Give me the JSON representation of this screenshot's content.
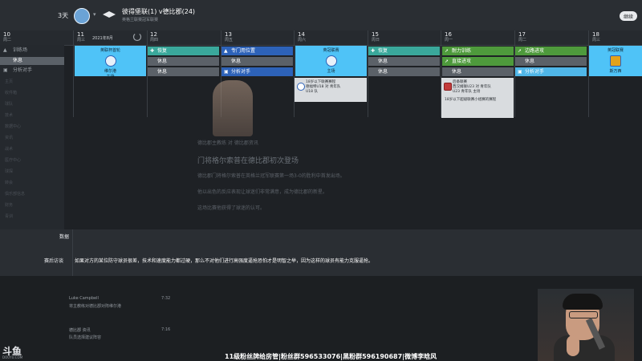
{
  "topbar": {
    "days_left": "3天",
    "match_title": "彼得堡联(1) v德比郡(24)",
    "match_sub": "英格兰联赛冠军联赛",
    "continue_button": "继续"
  },
  "calendar": {
    "month_label": "2021年8月",
    "days": [
      {
        "num": "10",
        "weekday": "周二"
      },
      {
        "num": "11",
        "weekday": "周三"
      },
      {
        "num": "12",
        "weekday": "周四"
      },
      {
        "num": "13",
        "weekday": "周五"
      },
      {
        "num": "14",
        "weekday": "周六"
      },
      {
        "num": "15",
        "weekday": "周日"
      },
      {
        "num": "16",
        "weekday": "周一"
      },
      {
        "num": "17",
        "weekday": "周二"
      },
      {
        "num": "18",
        "weekday": "周三"
      }
    ],
    "events": {
      "d10": [
        "训练场",
        "休息",
        "分析对手"
      ],
      "d11_card": {
        "name": "英联杯首轮",
        "opponent": "维尔港",
        "state": "主场"
      },
      "d12": [
        "恢复",
        "休息",
        "休息"
      ],
      "d13": [
        "专门用位置",
        "休息",
        "分析对手"
      ],
      "d14_card": {
        "name": "英冠联赛",
        "opponent": "",
        "state": "主场"
      },
      "d15": [
        "恢复",
        "休息",
        "休息"
      ],
      "d16": [
        "耐力训练",
        "直接进攻",
        "休息"
      ],
      "d17": [
        "边路进攻",
        "休息",
        "分析对手"
      ],
      "d18_card": {
        "name": "英冠联赛",
        "opponent": "斯万西",
        "state": "客场"
      }
    },
    "popover_a": {
      "line1": "18岁以下联赛赛程",
      "line2": "德福特U18 对 青年队",
      "line3": "U18 队"
    },
    "popover_b": {
      "line1": "后备联赛",
      "line2": "西汉姆联U23 对 青年队",
      "line3": "U23 青年队 主场",
      "line4": "18岁以下超级联赛小组赛的赛程"
    }
  },
  "sidebar": {
    "items": [
      "训练场",
      "休息",
      "分析对手"
    ],
    "dim": [
      "主页",
      "收件箱",
      "球队",
      "技术",
      "数据中心",
      "资讯",
      "战术",
      "医疗中心",
      "球探",
      "转会",
      "俱乐部信息",
      "财务",
      "青训"
    ]
  },
  "news": {
    "title": "门将格尔索普在德比郡初次登场",
    "header": "德比郡主教练 对 德比郡资讯",
    "lines": [
      "德比郡门将格尔索普在英格兰冠军联赛第一场3-0的胜利中首发出场。",
      "他以出色的反应表现让球迷们非常满意，成为德比郡的新星。",
      "这场比赛他获得了球迷的认可。"
    ]
  },
  "lower": {
    "label_a": "数据",
    "label_b": "赛后访谈",
    "text": "如果对方的某位防守球员很差，技术和速度能力都过硬，那么不对他们进行高强度逼抢恐怕才是明智之举，因为这样的球员有能力克服逼抢。"
  },
  "messages": [
    {
      "from": "Luke Campbell",
      "text": "将主教练对德比郡对阵维尔港",
      "time": "7:32"
    },
    {
      "from": "德比郡 资讯",
      "text": "队员选择建议阵容",
      "time": "7:16"
    }
  ],
  "stream": {
    "banner": "11级粉丝牌给房管|粉丝群596533076|黑粉群596190687|微博李晗风",
    "logo": "斗鱼",
    "logo_sub": "DOUYU.COM"
  },
  "colors": {
    "teal": "#3aa89b",
    "blue": "#2d62b8",
    "green": "#4e9a3c",
    "cyan": "#4fc3f7",
    "gray": "#5b6168"
  }
}
